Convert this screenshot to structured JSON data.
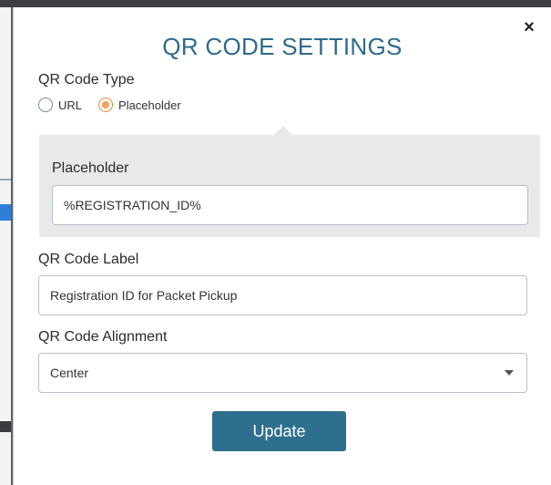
{
  "modal": {
    "title": "QR CODE SETTINGS",
    "close_symbol": "×",
    "qr_type": {
      "label": "QR Code Type",
      "options": [
        {
          "label": "URL",
          "checked": false
        },
        {
          "label": "Placeholder",
          "checked": true
        }
      ]
    },
    "placeholder": {
      "label": "Placeholder",
      "value": "%REGISTRATION_ID%"
    },
    "qr_label": {
      "label": "QR Code Label",
      "value": "Registration ID for Packet Pickup"
    },
    "alignment": {
      "label": "QR Code Alignment",
      "value": "Center"
    },
    "update_label": "Update"
  },
  "colors": {
    "title": "#2e6a8a",
    "button": "#2f6f8e",
    "radio_selected": "#e8833a",
    "panel": "#e7e9eb"
  }
}
